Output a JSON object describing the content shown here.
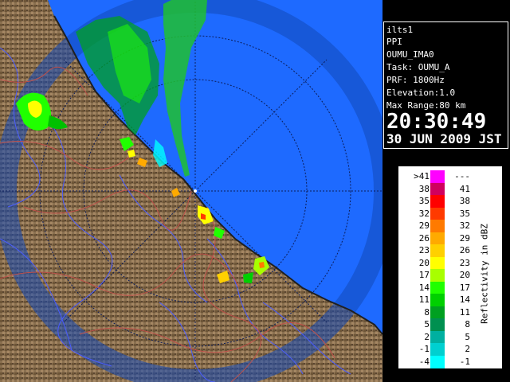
{
  "radar_view": {
    "background_land": "#8a7050",
    "sea_color": "#1e6aff",
    "range_ring_color": "#0c1d5a"
  },
  "info_panel": {
    "radar_name": "ilts1",
    "scan_type": "PPI",
    "site": "OUMU_IMA0",
    "task": "Task: OUMU_A",
    "prf": "PRF: 1800Hz",
    "elevation": "Elevation:1.0",
    "max_range": "Max Range:80 km",
    "time": "20:30:49",
    "date": "30 JUN 2009 JST"
  },
  "legend": {
    "unit_label": "Reflectivity in dBZ",
    "rows": [
      {
        "low": ">41",
        "high": "---",
        "color": "#ff00ff"
      },
      {
        "low": "38",
        "high": "41",
        "color": "#d0005e"
      },
      {
        "low": "35",
        "high": "38",
        "color": "#ff0000"
      },
      {
        "low": "32",
        "high": "35",
        "color": "#ff3a00"
      },
      {
        "low": "29",
        "high": "32",
        "color": "#ff7a00"
      },
      {
        "low": "26",
        "high": "29",
        "color": "#ffaa00"
      },
      {
        "low": "23",
        "high": "26",
        "color": "#ffd000"
      },
      {
        "low": "20",
        "high": "23",
        "color": "#ffff00"
      },
      {
        "low": "17",
        "high": "20",
        "color": "#a8ff00"
      },
      {
        "low": "14",
        "high": "17",
        "color": "#20ff00"
      },
      {
        "low": "11",
        "high": "14",
        "color": "#00d000"
      },
      {
        "low": "8",
        "high": "11",
        "color": "#00a020"
      },
      {
        "low": "5",
        "high": "8",
        "color": "#009050"
      },
      {
        "low": "2",
        "high": "5",
        "color": "#00b0a0"
      },
      {
        "low": "-1",
        "high": "2",
        "color": "#00d0d0"
      },
      {
        "low": "-4",
        "high": "-1",
        "color": "#00ffff"
      }
    ]
  }
}
